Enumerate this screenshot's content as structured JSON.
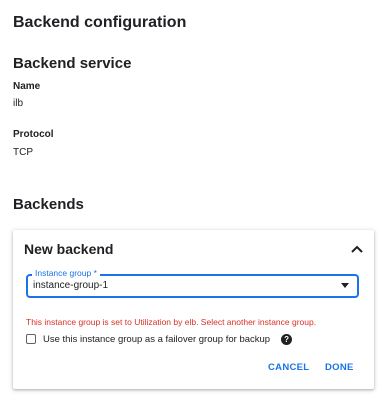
{
  "header": {
    "title": "Backend configuration"
  },
  "backend_service": {
    "section_title": "Backend service",
    "name_label": "Name",
    "name_value": "ilb",
    "protocol_label": "Protocol",
    "protocol_value": "TCP"
  },
  "backends": {
    "section_title": "Backends",
    "card": {
      "title": "New backend",
      "collapse_icon": "chevron-up-icon",
      "instance_group": {
        "label": "Instance group *",
        "value": "instance-group-1",
        "dropdown_icon": "dropdown-arrow-icon"
      },
      "error_message": "This instance group is set to Utilization by elb. Select another instance group.",
      "failover_checkbox": {
        "label": "Use this instance group as a failover group for backup",
        "checked": false,
        "help_icon": "help-icon",
        "help_glyph": "?"
      },
      "cancel_label": "CANCEL",
      "done_label": "DONE"
    }
  },
  "colors": {
    "accent": "#1a73e8",
    "error": "#d93025",
    "text": "#202124"
  }
}
